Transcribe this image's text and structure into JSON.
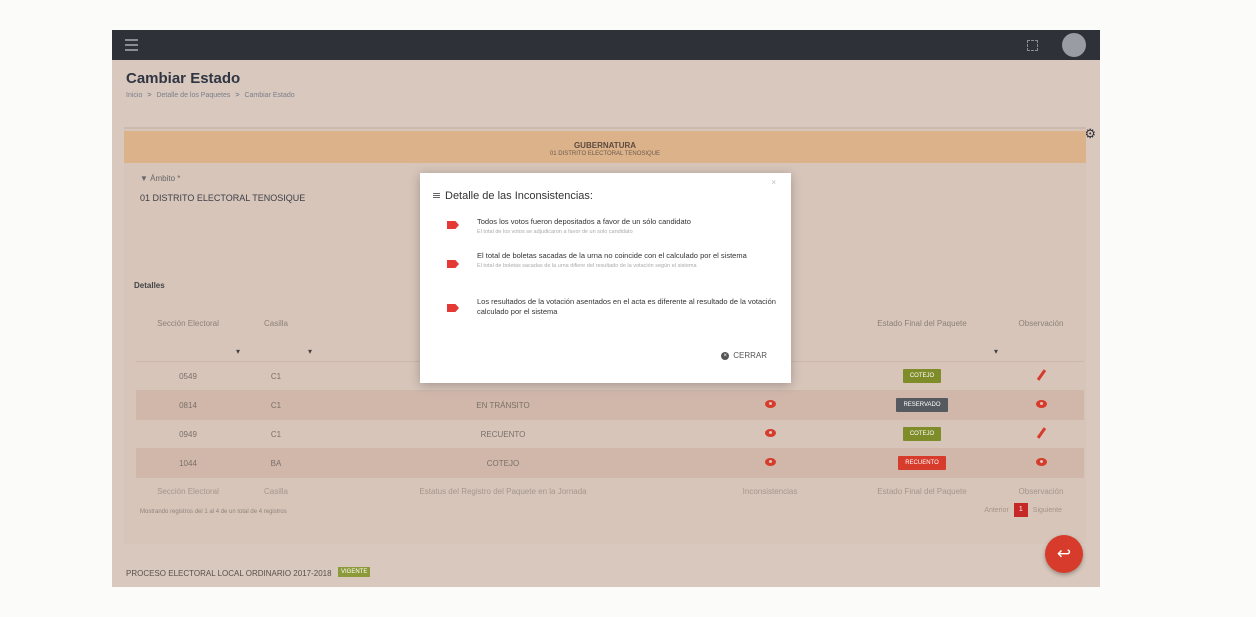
{
  "page": {
    "title": "Cambiar Estado",
    "breadcrumb": [
      "Inicio",
      "Detalle de los Paquetes",
      "Cambiar Estado"
    ]
  },
  "election": {
    "office": "GUBERNATURA",
    "district": "01 DISTRITO ELECTORAL TENOSIQUE"
  },
  "filter": {
    "label": "Ámbito *",
    "value": "01 DISTRITO ELECTORAL TENOSIQUE"
  },
  "details_title": "Detalles",
  "table": {
    "headers": [
      "Sección Electoral",
      "Casilla",
      "Estatus del Registro del Paquete en la Jornada",
      "Inconsistencias",
      "Estado Final del Paquete",
      "Observación"
    ],
    "rows": [
      {
        "seccion": "0549",
        "casilla": "C1",
        "estatus": "",
        "estado_final": "COTEJO",
        "estado_color": "#7f8c2a",
        "accion": "pencil-icon"
      },
      {
        "seccion": "0814",
        "casilla": "C1",
        "estatus": "EN TRÁNSITO",
        "estado_final": "RESERVADO",
        "estado_color": "#555a60",
        "accion": "eye-icon"
      },
      {
        "seccion": "0949",
        "casilla": "C1",
        "estatus": "RECUENTO",
        "estado_final": "COTEJO",
        "estado_color": "#7f8c2a",
        "accion": "pencil-icon"
      },
      {
        "seccion": "1044",
        "casilla": "BA",
        "estatus": "COTEJO",
        "estado_final": "RECUENTO",
        "estado_color": "#d63b2b",
        "accion": "eye-icon"
      }
    ],
    "footer": "Mostrando registros del 1 al 4 de un total de 4 registros",
    "pager": {
      "prev": "Anterior",
      "page": "1",
      "next": "Siguiente"
    }
  },
  "bottom": {
    "process": "PROCESO ELECTORAL LOCAL ORDINARIO 2017-2018",
    "state": "VIGENTE"
  },
  "modal": {
    "title": "Detalle de las Inconsistencias:",
    "items": [
      {
        "main": "Todos los votos fueron depositados a favor de un sólo candidato",
        "sub": "El total de los votos se adjudicaron a favor de un solo candidato"
      },
      {
        "main": "El total de boletas sacadas de la urna no coincide con el calculado por el sistema",
        "sub": "El total de boletas sacadas de la urna difiere del resultado de la votación según el sistema"
      },
      {
        "main": "Los resultados de la votación asentados en el acta es diferente al resultado de la votación calculado por el sistema",
        "sub": ""
      }
    ],
    "close_label": "CERRAR"
  }
}
